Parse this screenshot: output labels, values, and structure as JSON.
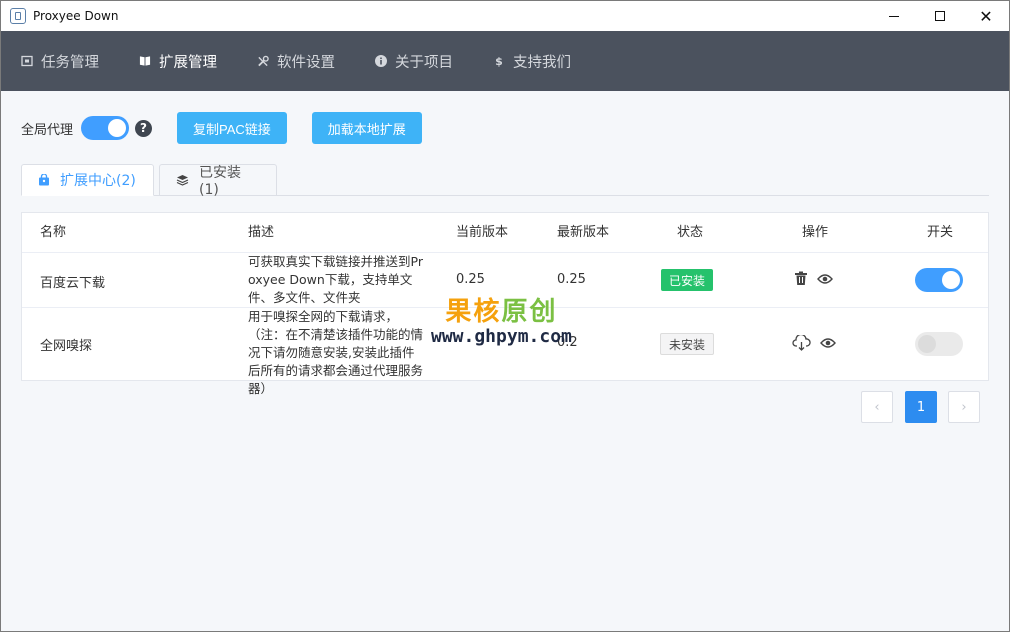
{
  "window": {
    "title": "Proxyee Down"
  },
  "nav": {
    "items": [
      {
        "label": "任务管理",
        "icon": "task-icon"
      },
      {
        "label": "扩展管理",
        "icon": "extension-icon"
      },
      {
        "label": "软件设置",
        "icon": "tools-icon"
      },
      {
        "label": "关于项目",
        "icon": "info-icon"
      },
      {
        "label": "支持我们",
        "icon": "dollar-icon"
      }
    ],
    "active_index": 1
  },
  "toolbar": {
    "proxy_label": "全局代理",
    "proxy_on": true,
    "copy_pac_label": "复制PAC链接",
    "load_local_label": "加载本地扩展"
  },
  "tabs": [
    {
      "label": "扩展中心(2)",
      "icon": "bag-icon"
    },
    {
      "label": "已安装(1)",
      "icon": "layers-icon"
    }
  ],
  "table": {
    "headers": [
      "名称",
      "描述",
      "当前版本",
      "最新版本",
      "状态",
      "操作",
      "开关"
    ],
    "rows": [
      {
        "name": "百度云下载",
        "description": "可获取真实下载链接并推送到Proxyee Down下载，支持单文件、多文件、文件夹",
        "current_version": "0.25",
        "latest_version": "0.25",
        "status": "已安装",
        "enabled": true
      },
      {
        "name": "全网嗅探",
        "description": "用于嗅探全网的下载请求，（注：在不清楚该插件功能的情况下请勿随意安装,安装此插件后所有的请求都会通过代理服务器）",
        "current_version": "",
        "latest_version": "0.2",
        "status": "未安装",
        "enabled": false
      }
    ]
  },
  "pagination": {
    "prev": "‹",
    "current": "1",
    "next": "›"
  },
  "watermark": {
    "title_part1": "果核",
    "title_part2": "原创",
    "url": "www.ghpym.com"
  },
  "colors": {
    "accent": "#409eff",
    "installed": "#25c26c",
    "nav_bg": "#4b525e",
    "button": "#3eb3f7"
  }
}
